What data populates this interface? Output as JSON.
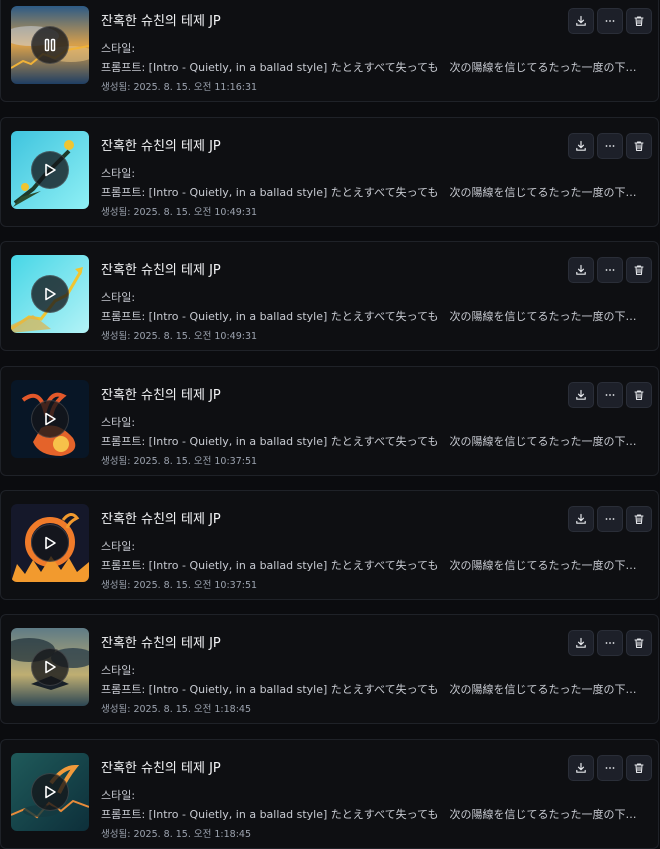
{
  "items": [
    {
      "title": "잔혹한 슈친의 테제 JP",
      "style": "스타일:",
      "prompt": "프롬프트: [Intro - Quietly, in a ballad style] たとえすべて失っても　次の陽線を信じてるたった一度の下落で",
      "created": "생성됨: 2025. 8. 15. 오전 11:16:31",
      "state": "pause",
      "art": "sea-dawn"
    },
    {
      "title": "잔혹한 슈친의 테제 JP",
      "style": "스타일:",
      "prompt": "프롬프트: [Intro - Quietly, in a ballad style] たとえすべて失っても　次の陽線を信じてるたった一度の下落で",
      "created": "생성됨: 2025. 8. 15. 오전 10:49:31",
      "state": "play",
      "art": "cyan-flower"
    },
    {
      "title": "잔혹한 슈친의 테제 JP",
      "style": "스타일:",
      "prompt": "프롬프트: [Intro - Quietly, in a ballad style] たとえすべて失っても　次の陽線を信じてるたった一度の下落で",
      "created": "생성됨: 2025. 8. 15. 오전 10:49:31",
      "state": "play",
      "art": "cyan-chart"
    },
    {
      "title": "잔혹한 슈친의 테제 JP",
      "style": "스타일:",
      "prompt": "프롬프트: [Intro - Quietly, in a ballad style] たとえすべて失っても　次の陽線を信じてるたった一度の下落で",
      "created": "생성됨: 2025. 8. 15. 오전 10:37:51",
      "state": "play",
      "art": "phoenix-dark"
    },
    {
      "title": "잔혹한 슈친의 테제 JP",
      "style": "스타일:",
      "prompt": "프롬프트: [Intro - Quietly, in a ballad style] たとえすべて失っても　次の陽線を信じてるたった一度の下落で",
      "created": "생성됨: 2025. 8. 15. 오전 10:37:51",
      "state": "play",
      "art": "fire-ring"
    },
    {
      "title": "잔혹한 슈친의 테제 JP",
      "style": "스타일:",
      "prompt": "프롬프트: [Intro - Quietly, in a ballad style] たとえすべて失っても　次の陽線を信じてるたった一度の下落で",
      "created": "생성됨: 2025. 8. 15. 오전 1:18:45",
      "state": "play",
      "art": "storm-sky"
    },
    {
      "title": "잔혹한 슈친의 테제 JP",
      "style": "스타일:",
      "prompt": "프롬프트: [Intro - Quietly, in a ballad style] たとえすべて失っても　次の陽線を信じてるたった一度の下落で",
      "created": "생성됨: 2025. 8. 15. 오전 1:18:45",
      "state": "play",
      "art": "teal-phoenix"
    }
  ],
  "actions": {
    "download": "download-icon",
    "more": "more-icon",
    "delete": "trash-icon"
  }
}
